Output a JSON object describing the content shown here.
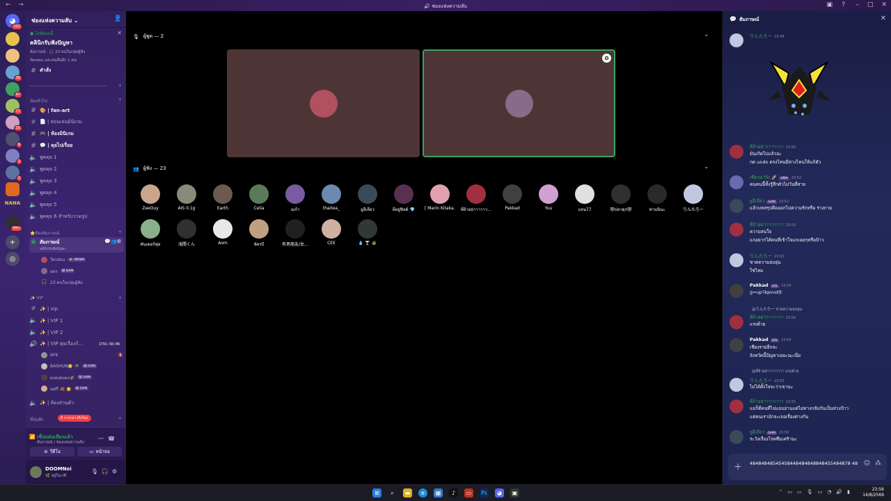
{
  "window": {
    "title": "ช่องแห่งความลับ"
  },
  "rail": {
    "badges": [
      "122",
      "30",
      "47",
      "77",
      "21",
      "6",
      "3",
      "3",
      "99+"
    ],
    "logo_text": "NANA"
  },
  "sidebar": {
    "server_name": "ช่องแห่งความลับ",
    "event": {
      "live_label": "● ไลฟ์ตอนนี้",
      "title": "คลินิกรับฟังปัญหา",
      "meta": "สัมภาษณ์ · 🎧 23 คนในกลุ่มผู้ฟัง",
      "host": "Tendou และคนอื่นอีก 1 คน"
    },
    "top_channels": [
      {
        "label": "คำสั่ง"
      }
    ],
    "divider_label": "-------------------------------------------------------",
    "category_chat": "ห้องทั่วไป",
    "chat_channels": [
      {
        "label": "🎨 | fan-art"
      },
      {
        "label": "📄 | สอนเล่นมินิเกม"
      },
      {
        "label": "🎮 | ห้องมินิเกม"
      },
      {
        "label": "💬 | คุยไปเรื่อย"
      }
    ],
    "voice_channels": [
      {
        "label": "พูดคุย 1"
      },
      {
        "label": "พูดคุย 2"
      },
      {
        "label": "พูดคุย 3"
      },
      {
        "label": "พูดคุย 4"
      },
      {
        "label": "พูดคุย 5"
      },
      {
        "label": "พูดคุย 6 สำหรับวาดรูป"
      }
    ],
    "category_stage": "⭐ห้องสัมภาษณ์",
    "stage_channel": {
      "label": "สัมภาษณ์",
      "sub": "คลินิกรับฟังปัญหา",
      "members": [
        {
          "name": "Tendou",
          "tag": "🐝 WUWA"
        },
        {
          "name": "ษยร",
          "tag": "😺 GAM"
        },
        {
          "name": "23 คนในกลุ่มผู้ฟัง",
          "tag": ""
        }
      ]
    },
    "category_vip": "✨ VIP",
    "vip_channels": [
      {
        "label": "✨ | vip"
      },
      {
        "label": "✨ | VIP 1"
      },
      {
        "label": "✨ | VIP 2"
      },
      {
        "label": "✨ | VIP คุยเรื่องก้...",
        "timer": "1791:56:06"
      }
    ],
    "vip_members": [
      {
        "name": "AFK",
        "tag": ""
      },
      {
        "name": "BASHUN🌟 🎋",
        "tag": "😺 GAM"
      },
      {
        "name": "คงคงคงคง🌾",
        "tag": "😺 GAM"
      },
      {
        "name": "ษeff 🍂 🌟",
        "tag": "😺 GAM"
      }
    ],
    "private_channel": {
      "label": "✨ | ห้องส่วนตัว"
    },
    "category_misc": "ที่บันทึก",
    "new_mentions": "8 การกล่าวถึงใหม่",
    "voice": {
      "status": "เชื่อมต่อเสียงแล้ว",
      "location": "สัมภาษณ์ / ช่องแห่งความลับ",
      "video_label": "วีดีโอ",
      "screen_label": "หน้าจอ"
    },
    "user": {
      "name": "DOOMNoi",
      "status": "🌿 อยู่ในเวที"
    }
  },
  "stage": {
    "speakers_label": "ผู้พูด — 2",
    "audience_label": "ผู้ฟัง — 23",
    "speakers": [
      {
        "name": "Tendou",
        "color": "#b05060"
      },
      {
        "name": "ษยร",
        "color": "#8a6a8a",
        "speaking": true
      }
    ],
    "audience": [
      {
        "name": "ZeeOuy",
        "color": "#c9a58c"
      },
      {
        "name": "AIS 0.1g",
        "color": "#8a8a7a"
      },
      {
        "name": "Earth",
        "color": "#6a5a50"
      },
      {
        "name": "Celia",
        "color": "#5a7a5a"
      },
      {
        "name": "เมก้า",
        "color": "#7a5aa0"
      },
      {
        "name": "thaitea_",
        "color": "#6a8ab0"
      },
      {
        "name": "ยูอีเลียว",
        "color": "#3a4a5a"
      },
      {
        "name": "ผีอยู่ฟิลด์ 💎",
        "color": "#5a3050"
      },
      {
        "name": "[ Marin Kitaka...",
        "color": "#e0a0b0"
      },
      {
        "name": "พี่จ้าอย่าาาาาา...",
        "color": "#a03040"
      },
      {
        "name": "Pakkad",
        "color": "#404040"
      },
      {
        "name": "Yuu",
        "color": "#d0a0d0"
      },
      {
        "name": "แจน77",
        "color": "#e0e0e0"
      },
      {
        "name": "😻ปลาดุก😻",
        "color": "#303030"
      },
      {
        "name": "ท่านนินะ",
        "color": "#2a2a2a"
      },
      {
        "name": "りんたろー",
        "color": "#c0c8e0"
      },
      {
        "name": "คันเดอร์ฟุล",
        "color": "#8ab08a"
      },
      {
        "name": "浅間くん",
        "color": "#303030"
      },
      {
        "name": "Aom",
        "color": "#e8e8e8"
      },
      {
        "name": "ลัครบี",
        "color": "#c0a080"
      },
      {
        "name": "有男朋友/女...",
        "color": "#202020"
      },
      {
        "name": "CEE",
        "color": "#d0b0a0"
      },
      {
        "name": "💧 🍸 🪴",
        "color": "#303838"
      }
    ]
  },
  "chat": {
    "title": "สัมภาษณ์",
    "messages": [
      {
        "author": "りんたろー",
        "time": "23:49",
        "lines": [],
        "color": "#c0c8e0"
      },
      {
        "author": "พี่จ้าอย่าาาาาาาา",
        "time": "23:50",
        "lines": [
          "มันเกิดไปแล้วอะ",
          "กด undo ตรงไหนมีทางไหนให้แก้ตัว"
        ],
        "color": "#a03040"
      },
      {
        "author": "เขียวฉาจิง 🚀",
        "tag": "UMA",
        "time": "23:52",
        "lines": [
          "คนคนนี้ทั้งรู้สึกตัวไม่วันที่สาย"
        ],
        "color": "#6a6ab0"
      },
      {
        "author": "ยูอีเลียว",
        "tag": "GAM",
        "time": "23:52",
        "lines": [
          "แล้วบทสรุปคือออกไปความรักหรือ ร่างกาย"
        ],
        "color": "#3a4a5a"
      },
      {
        "author": "พี่จ้าอย่าาาาาาาา",
        "time": "23:53",
        "lines": [
          "ความสนใจ",
          "แกอยากได้คนที่เข้าใจแกเฉยๆหรือป้าว"
        ],
        "color": "#a03040"
      },
      {
        "author": "りんたろー",
        "time": "23:53",
        "lines": [
          "ขาดความอบอุ่น",
          "ใช่ไหม"
        ],
        "color": "#c0c8e0"
      },
      {
        "author": "Pakkad",
        "tag": "LOL",
        "time": "23:54",
        "lines": [
          "g=up'ikpvud]t"
        ],
        "white": true,
        "color": "#404040"
      },
      {
        "reply": "@りんたろー ขาดความอบอุ่น",
        "author": "พี่จ้าอย่าาาาาาาา",
        "time": "23:54",
        "lines": [
          "แรงด้าย"
        ],
        "color": "#a03040"
      },
      {
        "author": "Pakkad",
        "tag": "LOL",
        "time": "23:54",
        "lines": [
          "เชียงรายอีกละ",
          "จังหวัดนี้ปัญหาเยอะนะเนี่ย"
        ],
        "white": true,
        "color": "#404040"
      },
      {
        "reply": "@พี่จ้าอย่าาาาาาาา แรงด้าย",
        "author": "りんたろー",
        "time": "23:55",
        "lines": [
          "ไม่ได้ตั้งใจจะว่าเขานะ"
        ],
        "color": "#c0c8e0"
      },
      {
        "author": "พี่จ้าอย่าาาาาาาา",
        "time": "23:55",
        "lines": [
          "แม่ก็ดีคนที่ไปแอบอ่านแต่ไม่ทางกลับกันเป็นห่วงป้าว",
          "แต่คนเรามักจะเจอเรื่องต่างกัน"
        ],
        "color": "#a03040"
      },
      {
        "author": "ยูอีเลียว",
        "tag": "GAM",
        "time": "23:56",
        "lines": [
          "ระวังเรื่องโรคซึมเศร้านะ"
        ],
        "color": "#3a4a5a"
      }
    ],
    "composer_text": "48484848545458448484848848455484878 48"
  },
  "taskbar": {
    "time": "23:56",
    "date": "14/8/2569"
  },
  "colors": {
    "accent_green": "#3ba55d",
    "mention_red": "#f23f43"
  }
}
